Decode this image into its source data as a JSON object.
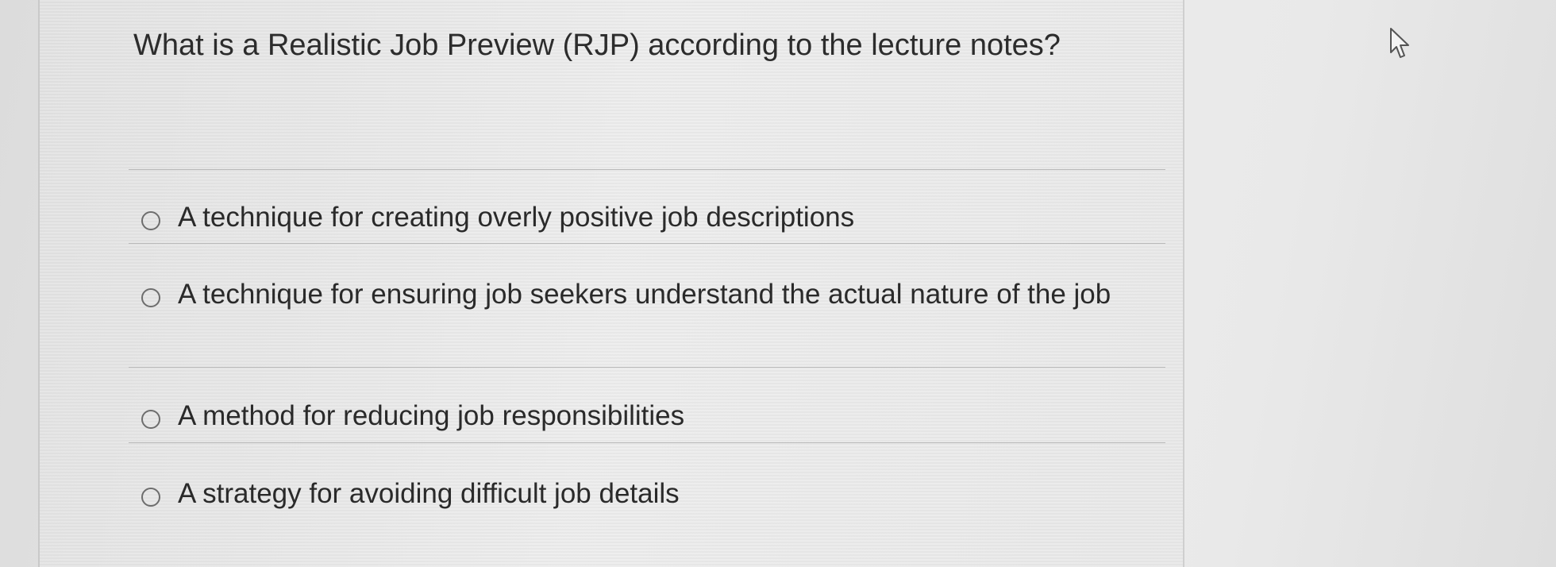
{
  "quiz": {
    "question": "What is a Realistic Job Preview (RJP) according to the lecture notes?",
    "options": [
      {
        "label": "A technique for creating overly positive job descriptions"
      },
      {
        "label": "A technique for ensuring job seekers understand the actual nature of the job"
      },
      {
        "label": "A method for reducing job responsibilities"
      },
      {
        "label": "A strategy for avoiding difficult job details"
      }
    ]
  },
  "icons": {
    "radio": "radio-unselected-icon",
    "cursor": "mouse-pointer-icon"
  },
  "colors": {
    "text": "#2c2c2c",
    "radio_border": "#6d6d6d",
    "divider": "#b9b9b9",
    "background": "#e6e6e6"
  }
}
